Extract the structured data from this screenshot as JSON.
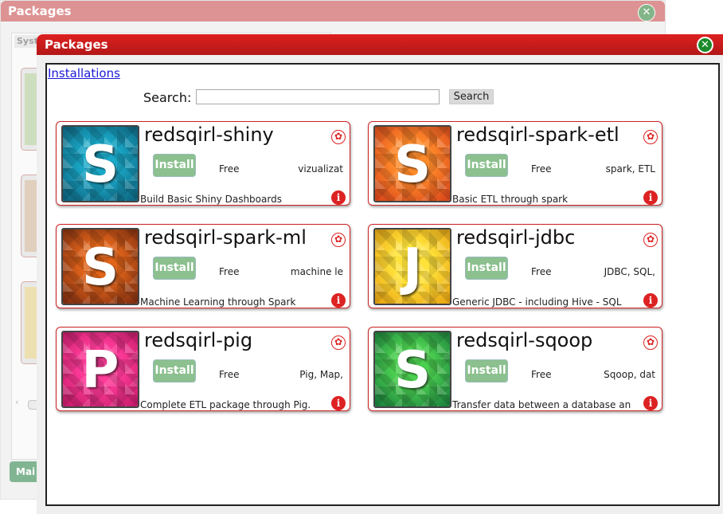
{
  "background_window": {
    "title": "Packages",
    "tab_label": "Syste",
    "main_button_label": "Mai"
  },
  "dialog": {
    "title": "Packages",
    "close_symbol": "✕"
  },
  "installations_link": "Installations",
  "search": {
    "label": "Search:",
    "value": "",
    "button": "Search"
  },
  "packages": [
    {
      "name": "redsqirl-shiny",
      "letter": "S",
      "install_label": "Install",
      "price": "Free",
      "tags": "vizualizat",
      "description": "Build Basic Shiny Dashboards",
      "colors": [
        "#1aa8c8",
        "#0d5f7a"
      ]
    },
    {
      "name": "redsqirl-spark-etl",
      "letter": "S",
      "install_label": "Install",
      "price": "Free",
      "tags": "spark, ETL",
      "description": "Basic ETL through spark",
      "colors": [
        "#ff8a2a",
        "#d8421a"
      ]
    },
    {
      "name": "redsqirl-spark-ml",
      "letter": "S",
      "install_label": "Install",
      "price": "Free",
      "tags": "machine le",
      "description": "Machine Learning through Spark",
      "colors": [
        "#e0641a",
        "#7a2a10"
      ]
    },
    {
      "name": "redsqirl-jdbc",
      "letter": "J",
      "install_label": "Install",
      "price": "Free",
      "tags": "JDBC, SQL,",
      "description": "Generic JDBC - including Hive - SQL",
      "colors": [
        "#ffe23a",
        "#e8a010"
      ]
    },
    {
      "name": "redsqirl-pig",
      "letter": "P",
      "install_label": "Install",
      "price": "Free",
      "tags": "Pig, Map,",
      "description": "Complete ETL package through Pig.",
      "colors": [
        "#ff3c9a",
        "#c21866"
      ]
    },
    {
      "name": "redsqirl-sqoop",
      "letter": "S",
      "install_label": "Install",
      "price": "Free",
      "tags": "Sqoop, dat",
      "description": "Transfer data between a database an",
      "colors": [
        "#4cd050",
        "#167a3c"
      ]
    }
  ],
  "icons": {
    "uninstall": "uninstall-icon",
    "info": "info-icon"
  }
}
